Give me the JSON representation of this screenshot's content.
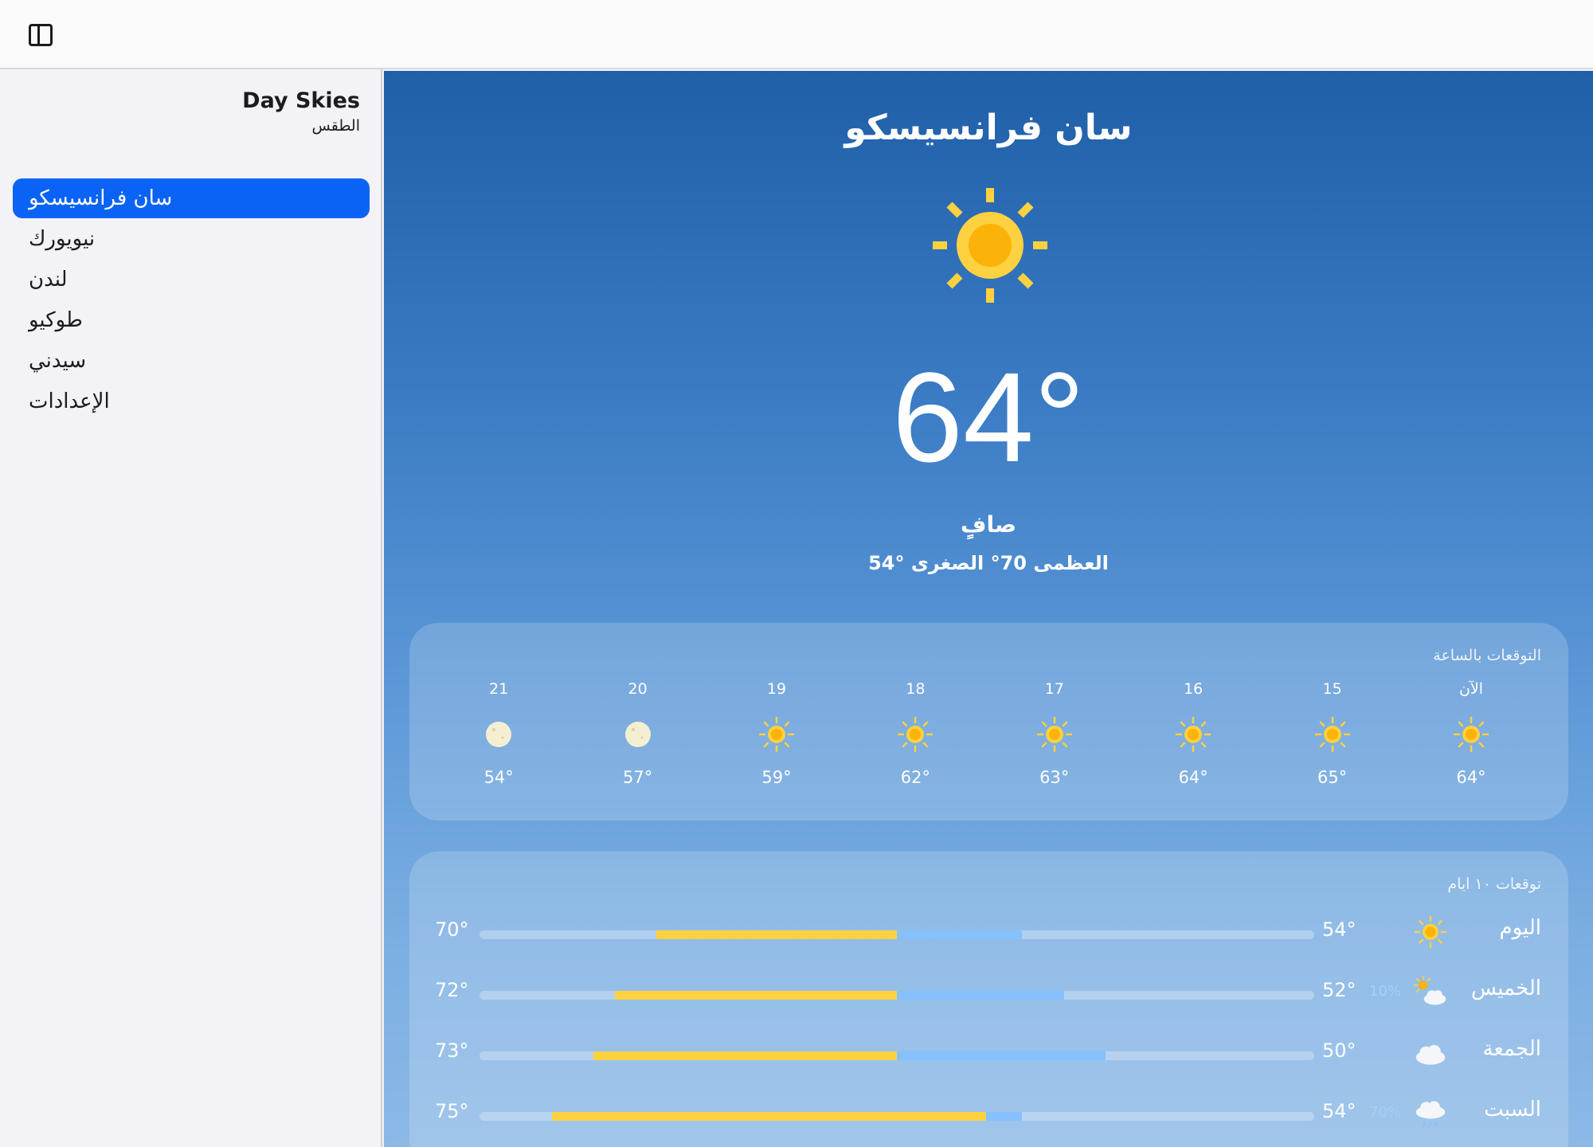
{
  "app": {
    "title": "Day Skies",
    "subtitle": "الطقس"
  },
  "sidebar": {
    "items": [
      {
        "label": "سان فرانسيسكو",
        "active": true
      },
      {
        "label": "نيويورك",
        "active": false
      },
      {
        "label": "لندن",
        "active": false
      },
      {
        "label": "طوكيو",
        "active": false
      },
      {
        "label": "سيدني",
        "active": false
      },
      {
        "label": "الإعدادات",
        "active": false
      }
    ]
  },
  "current": {
    "city": "سان فرانسيسكو",
    "temperature": "64°",
    "condition": "صافٍ",
    "hilo": "54° العظمى 70° الصغرى"
  },
  "hourly": {
    "title": "التوقعات بالساعة",
    "hours": [
      {
        "label": "الآن",
        "icon": "sun-icon",
        "temp": "64°"
      },
      {
        "label": "15",
        "icon": "sun-icon",
        "temp": "65°"
      },
      {
        "label": "16",
        "icon": "sun-icon",
        "temp": "64°"
      },
      {
        "label": "17",
        "icon": "sun-icon",
        "temp": "63°"
      },
      {
        "label": "18",
        "icon": "sun-icon",
        "temp": "62°"
      },
      {
        "label": "19",
        "icon": "sun-icon",
        "temp": "59°"
      },
      {
        "label": "20",
        "icon": "moon-icon",
        "temp": "57°"
      },
      {
        "label": "21",
        "icon": "moon-icon",
        "temp": "54°"
      }
    ]
  },
  "daily": {
    "title": "توقعات ١٠ ايام",
    "range": [
      40,
      80
    ],
    "days": [
      {
        "name": "اليوم",
        "icon": "sun-icon",
        "precip": "",
        "low": "54°",
        "high": "70°",
        "low_val": 54,
        "high_val": 70
      },
      {
        "name": "الخميس",
        "icon": "partly-cloudy-icon",
        "precip": "10%",
        "low": "52°",
        "high": "72°",
        "low_val": 52,
        "high_val": 72
      },
      {
        "name": "الجمعة",
        "icon": "cloud-icon",
        "precip": "",
        "low": "50°",
        "high": "73°",
        "low_val": 50,
        "high_val": 73
      },
      {
        "name": "السبت",
        "icon": "rain-icon",
        "precip": "70%",
        "low": "54°",
        "high": "75°",
        "low_val": 54,
        "high_val": 75
      }
    ]
  },
  "colors": {
    "accent": "#0a63f5",
    "sun": "#fdd13f",
    "sun_core": "#fbb309",
    "bar_blue": "#86c0ff",
    "bar_yellow": "#fdd13f"
  }
}
